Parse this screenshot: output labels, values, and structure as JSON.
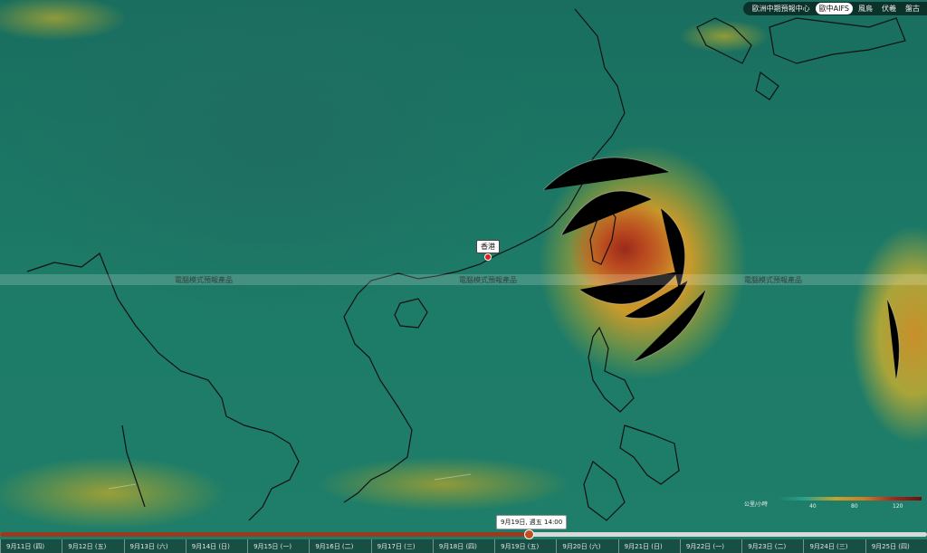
{
  "header_tabs": [
    {
      "label": "歐洲中期預報中心",
      "active": false
    },
    {
      "label": "歐中AIFS",
      "active": true
    },
    {
      "label": "風鳥",
      "active": false
    },
    {
      "label": "伏羲",
      "active": false
    },
    {
      "label": "盤古",
      "active": false
    }
  ],
  "watermark": "電腦模式預報產品",
  "city_label": "香港",
  "legend": {
    "title": "公里/小時",
    "ticks": [
      "40",
      "80",
      "120"
    ]
  },
  "timeline": {
    "current_label": "9月19日, 週五 14:00",
    "progress": 0.57,
    "dates": [
      "9月11日 (四)",
      "9月12日 (五)",
      "9月13日 (六)",
      "9月14日 (日)",
      "9月15日 (一)",
      "9月16日 (二)",
      "9月17日 (三)",
      "9月18日 (四)",
      "9月19日 (五)",
      "9月20日 (六)",
      "9月21日 (日)",
      "9月22日 (一)",
      "9月23日 (二)",
      "9月24日 (三)",
      "9月25日 (四)"
    ]
  },
  "colors": {
    "sea": "#1c7a66",
    "storm_core": "#9a2a1a",
    "storm_outer": "#d07a26"
  }
}
